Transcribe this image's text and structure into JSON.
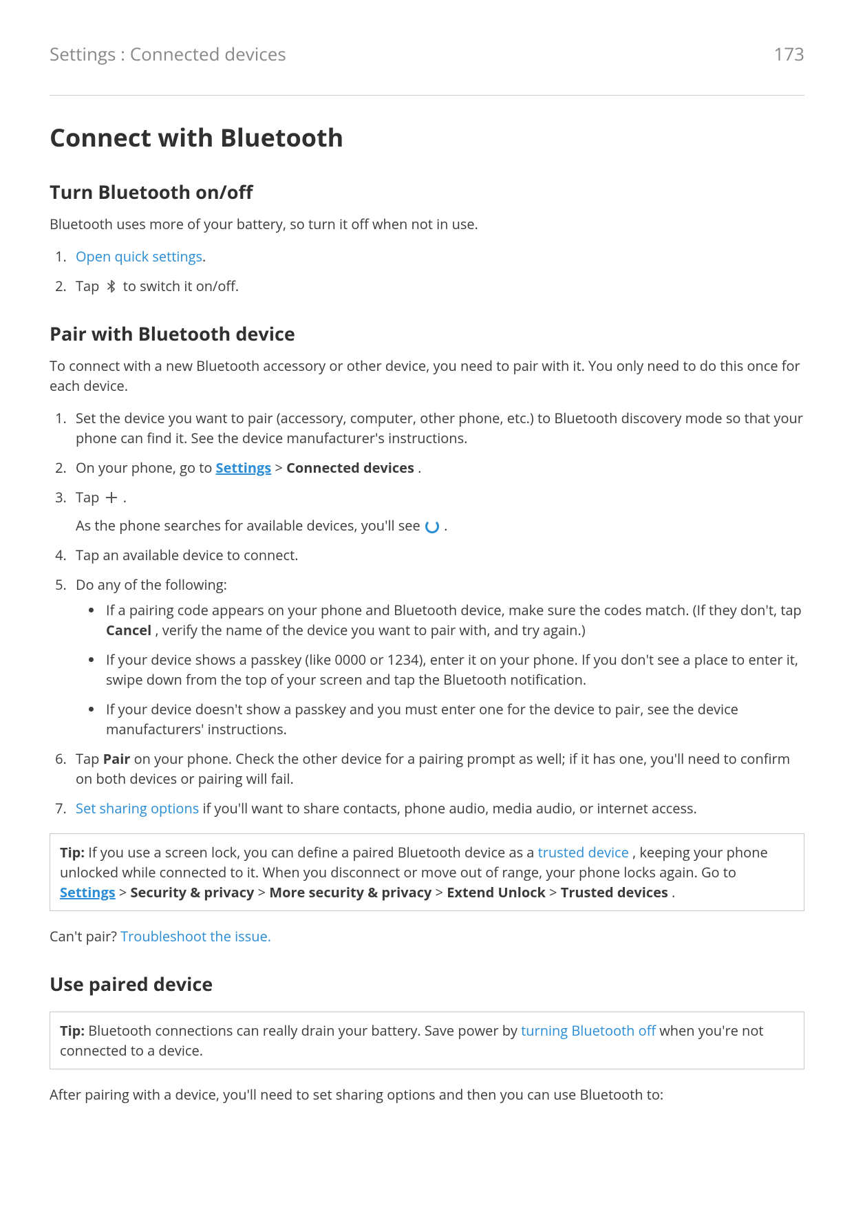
{
  "header": {
    "breadcrumb": "Settings : Connected devices",
    "page_number": "173"
  },
  "title": "Connect with Bluetooth",
  "s1": {
    "heading": "Turn Bluetooth on/off",
    "intro": "Bluetooth uses more of your battery, so turn it off when not in use.",
    "step1_link": "Open quick settings",
    "step1_suffix": ".",
    "step2_pre": "Tap ",
    "step2_post": " to switch it on/off."
  },
  "s2": {
    "heading": "Pair with Bluetooth device",
    "intro": "To connect with a new Bluetooth accessory or other device, you need to pair with it. You only need to do this once for each device.",
    "step1": "Set the device you want to pair (accessory, computer, other phone, etc.) to Bluetooth discovery mode so that your phone can find it. See the device manufacturer's instructions.",
    "step2_pre": "On your phone, go to ",
    "step2_settings": "Settings",
    "step2_gt": " > ",
    "step2_connected": "Connected devices",
    "step2_suffix": ".",
    "step3_pre": "Tap ",
    "step3_suffix": ".",
    "step3_note_pre": "As the phone searches for available devices, you'll see ",
    "step3_note_post": ".",
    "step4": "Tap an available device to connect.",
    "step5_lead": "Do any of the following:",
    "step5_b1_pre": "If a pairing code appears on your phone and Bluetooth device, make sure the codes match. (If they don't, tap ",
    "step5_b1_bold": "Cancel",
    "step5_b1_post": ", verify the name of the device you want to pair with, and try again.)",
    "step5_b2": "If your device shows a passkey (like 0000 or 1234), enter it on your phone. If you don't see a place to enter it, swipe down from the top of your screen and tap the Bluetooth notification.",
    "step5_b3": "If your device doesn't show a passkey and you must enter one for the device to pair, see the device manufacturers' instructions.",
    "step6_pre": "Tap ",
    "step6_bold": "Pair",
    "step6_post": " on your phone. Check the other device for a pairing prompt as well; if it has one, you'll need to confirm on both devices or pairing will fail.",
    "step7_link": "Set sharing options",
    "step7_post": " if you'll want to share contacts, phone audio, media audio, or internet access."
  },
  "tip1": {
    "label": "Tip:",
    "t1": " If you use a screen lock, you can define a paired Bluetooth device as a ",
    "trusted_link": "trusted device",
    "t2": ", keeping your phone unlocked while connected to it. When you disconnect or move out of range, your phone locks again. Go to ",
    "settings": "Settings",
    "gt": " > ",
    "p1": "Security & privacy",
    "p2": "More security & privacy",
    "p3": "Extend Unlock",
    "p4": "Trusted devices",
    "suffix": "."
  },
  "cant_pair": {
    "pre": "Can't pair? ",
    "link": "Troubleshoot the issue."
  },
  "s3": {
    "heading": "Use paired device"
  },
  "tip2": {
    "label": "Tip:",
    "t1": " Bluetooth connections can really drain your battery. Save power by ",
    "link": "turning Bluetooth off",
    "t2": " when you're not connected to a device."
  },
  "after_pair": "After pairing with a device, you'll need to set sharing options and then you can use Bluetooth to:"
}
